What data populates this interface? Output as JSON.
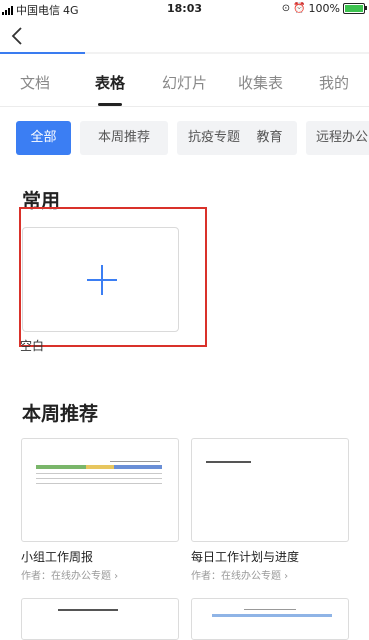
{
  "status_bar": {
    "carrier": "中国电信",
    "network": "4G",
    "time": "18:03",
    "battery": "100%",
    "battery_color": "#3cc24f"
  },
  "header": {
    "back_icon": "chevron-left-icon",
    "progress_color": "#3a7cf0"
  },
  "tabs": [
    {
      "label": "文档",
      "active": false
    },
    {
      "label": "表格",
      "active": true
    },
    {
      "label": "幻灯片",
      "active": false
    },
    {
      "label": "收集表",
      "active": false
    },
    {
      "label": "我的",
      "active": false
    }
  ],
  "categories": [
    {
      "label": "全部",
      "active": true
    },
    {
      "label": "本周推荐",
      "active": false
    },
    {
      "label": "抗疫专题",
      "active": false
    },
    {
      "label": "教育",
      "active": false
    },
    {
      "label": "远程办公",
      "active": false
    }
  ],
  "accent_color": "#3b7ef3",
  "highlight_color": "#d9312a",
  "common": {
    "title": "常用",
    "blank_label": "空白"
  },
  "weekly": {
    "title": "本周推荐",
    "templates": [
      {
        "title": "小组工作周报",
        "author": "作者：在线办公专题 ›"
      },
      {
        "title": "每日工作计划与进度",
        "author": "作者：在线办公专题 ›"
      }
    ]
  }
}
